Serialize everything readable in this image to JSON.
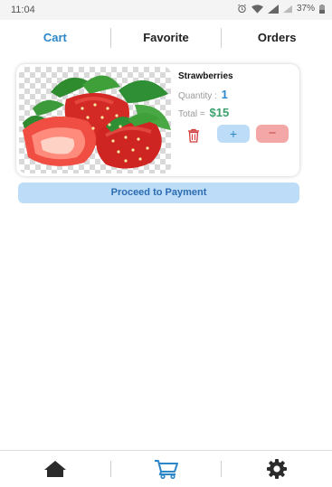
{
  "status_bar": {
    "time": "11:04",
    "battery": "37%",
    "icons": [
      "alarm-icon",
      "wifi-icon",
      "signal-icon",
      "battery-icon"
    ]
  },
  "tabs": [
    {
      "label": "Cart",
      "active": true
    },
    {
      "label": "Favorite",
      "active": false
    },
    {
      "label": "Orders",
      "active": false
    }
  ],
  "cart_item": {
    "name": "Strawberries",
    "quantity_label": "Quantity :",
    "quantity": "1",
    "total_label": "Total =",
    "total": "$15",
    "image": "strawberries-image",
    "plus_label": "+",
    "minus_label": "−"
  },
  "proceed_button": "Proceed to Payment",
  "bottom_nav": [
    {
      "icon": "home-icon",
      "active": false
    },
    {
      "icon": "cart-icon",
      "active": true
    },
    {
      "icon": "settings-icon",
      "active": false
    }
  ],
  "colors": {
    "accent": "#2c86c8",
    "total_green": "#3aa16d",
    "plus_bg": "#bcdcf8",
    "minus_bg": "#f4a7a7",
    "trash_red": "#d23b3b"
  }
}
